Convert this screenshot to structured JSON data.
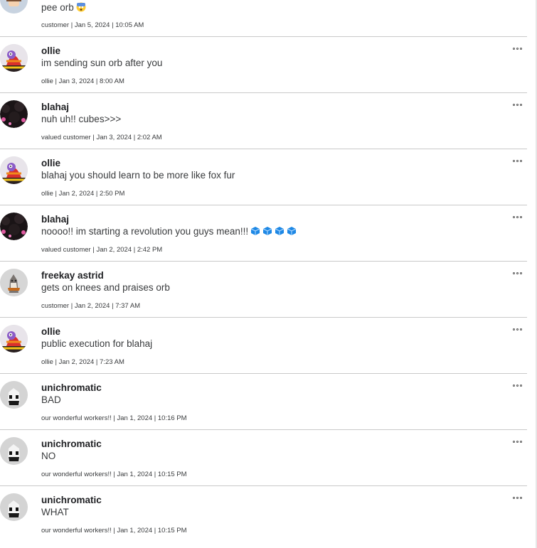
{
  "posts": [
    {
      "author": "",
      "body": "pee orb",
      "emoji": "scared-face",
      "meta": "customer | Jan 5, 2024 | 10:05 AM",
      "avatar": "white-avatar",
      "menu": false
    },
    {
      "author": "ollie",
      "body": "im sending sun orb after you",
      "meta": "ollie | Jan 3, 2024 | 8:00 AM",
      "avatar": "ollie-avatar",
      "menu": true
    },
    {
      "author": "blahaj",
      "body": "nuh uh!! cubes>>>",
      "meta": "valued customer | Jan 3, 2024 | 2:02 AM",
      "avatar": "blahaj-avatar",
      "menu": true
    },
    {
      "author": "ollie",
      "body": "blahaj you should learn to be more like fox fur",
      "meta": "ollie | Jan 2, 2024 | 2:50 PM",
      "avatar": "ollie-avatar",
      "menu": true
    },
    {
      "author": "blahaj",
      "body": "noooo!! im starting a revolution you guys mean!!!",
      "emoji": "blue-cube x4",
      "meta": "valued customer | Jan 2, 2024 | 2:42 PM",
      "avatar": "blahaj-avatar",
      "menu": true
    },
    {
      "author": "freekay astrid",
      "body": "gets on knees and praises orb",
      "meta": "customer | Jan 2, 2024 | 7:37 AM",
      "avatar": "astrid-avatar",
      "menu": true
    },
    {
      "author": "ollie",
      "body": "public execution for blahaj",
      "meta": "ollie | Jan 2, 2024 | 7:23 AM",
      "avatar": "ollie-avatar",
      "menu": true
    },
    {
      "author": "unichromatic",
      "body": "BAD",
      "meta": "our wonderful workers!! | Jan 1, 2024 | 10:16 PM",
      "avatar": "unichromatic-avatar",
      "menu": true
    },
    {
      "author": "unichromatic",
      "body": "NO",
      "meta": "our wonderful workers!! | Jan 1, 2024 | 10:15 PM",
      "avatar": "unichromatic-avatar",
      "menu": true
    },
    {
      "author": "unichromatic",
      "body": "WHAT",
      "meta": "our wonderful workers!! | Jan 1, 2024 | 10:15 PM",
      "avatar": "unichromatic-avatar",
      "menu": true
    }
  ],
  "colors": {
    "divider": "#c9c9c9",
    "text": "#393b3d",
    "author": "#202124",
    "cube": "#1e88e5"
  }
}
